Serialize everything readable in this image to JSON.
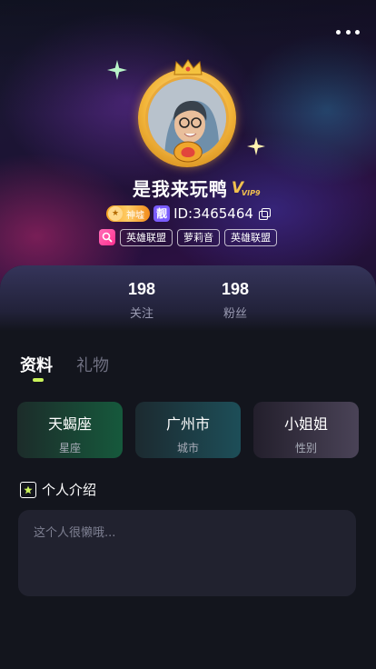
{
  "header": {
    "more_icon": "more-horizontal-icon"
  },
  "profile": {
    "name": "是我来玩鸭",
    "vip_label": "V",
    "vip_level": "VIP9",
    "rank_badge": "神墟",
    "liang_badge": "靓",
    "id_text": "ID:3465464",
    "tags": [
      "英雄联盟",
      "萝莉音",
      "英雄联盟"
    ]
  },
  "stats": {
    "following_count": "198",
    "following_label": "关注",
    "fans_count": "198",
    "fans_label": "粉丝"
  },
  "tabs": [
    {
      "label": "资料",
      "active": true
    },
    {
      "label": "礼物",
      "active": false
    }
  ],
  "info_cards": [
    {
      "value": "天蝎座",
      "key": "星座",
      "color": "#16593c"
    },
    {
      "value": "广州市",
      "key": "城市",
      "color": "#1d4e58"
    },
    {
      "value": "小姐姐",
      "key": "性别",
      "color": "#4a4357"
    }
  ],
  "intro": {
    "title": "个人介绍",
    "placeholder": "这个人很懒哦..."
  },
  "colors": {
    "accent": "#c9f25a",
    "background": "#13151d",
    "gold": "#f2c14e"
  }
}
